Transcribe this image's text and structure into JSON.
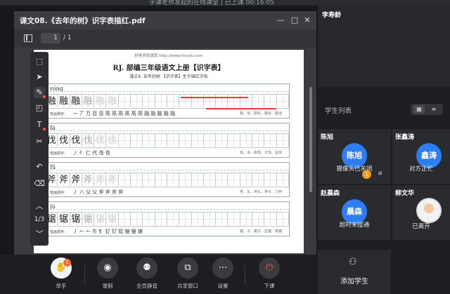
{
  "app": {
    "window_title": "字课老师发起的在线课堂 | 已上课 00:16:05"
  },
  "pdf": {
    "title": "课文08.《去年的树》识字表描红.pdf",
    "page_current": "1",
    "page_total": "/ 1",
    "site": "好老师资源库 http://www.hlszyk.com",
    "doc_title": "RJ. 部编三年级语文上册【识字表】",
    "doc_subtitle": "课文8. 去年的树 【识字表】生字描红字帖",
    "rows": [
      {
        "pinyin": "róng",
        "chars": [
          "融",
          "融",
          "融",
          "融",
          "融",
          "融",
          "",
          "",
          "",
          "",
          "",
          "",
          "",
          "",
          "",
          "",
          "",
          "",
          "",
          ""
        ],
        "words_label": "笔画顺序：",
        "strokes": "一 丆 万 百 百 鬲 鬲 鬲 鬲 鬲 鬲 融 融 融 融 融",
        "examples": "融、化、融化、融合、融洽"
      },
      {
        "pinyin": "fá",
        "chars": [
          "伐",
          "伐",
          "伐",
          "伐",
          "伐",
          "伐",
          "",
          "",
          "",
          "",
          "",
          "",
          "",
          "",
          "",
          "",
          "",
          "",
          "",
          ""
        ],
        "words_label": "笔画顺序：",
        "strokes": "丿 亻 仁 代 伐 伐",
        "examples": "伐、木、砍伐、讨伐、征伐"
      },
      {
        "pinyin": "fǔ",
        "chars": [
          "斧",
          "斧",
          "斧",
          "斧",
          "斧",
          "斧",
          "",
          "",
          "",
          "",
          "",
          "",
          "",
          "",
          "",
          "",
          "",
          "",
          "",
          ""
        ],
        "words_label": "笔画顺序：",
        "strokes": "丿 八 父 父 斧 斧 斧 斧",
        "examples": "斧、头、斧头、斧子、刀斧"
      },
      {
        "pinyin": "jù",
        "chars": [
          "锯",
          "锯",
          "锯",
          "锯",
          "锯",
          "锯",
          "",
          "",
          "",
          "",
          "",
          "",
          "",
          "",
          "",
          "",
          "",
          "",
          "",
          ""
        ],
        "words_label": "笔画顺序：",
        "strokes": "丿 𠂉 𠂉 牛 钅 钌 钌 铝 锯 锯 锯",
        "examples": "锯、子、锯子、拉锯、电锯"
      }
    ],
    "toolbar_pager": {
      "current": "1",
      "sep": "/",
      "total": "3"
    }
  },
  "right_panel": {
    "teacher_name": "李寿龄",
    "students_title": "学生列表",
    "students": [
      {
        "name": "陈旭",
        "avatar_text": "陈旭",
        "status": "摄像头已关闭",
        "hand_badge": "1"
      },
      {
        "name": "张鑫涛",
        "avatar_text": "鑫涛",
        "status": "对方正忙"
      },
      {
        "name": "赵晨森",
        "avatar_text": "晨森",
        "status": "超时未接通"
      },
      {
        "name": "柳文华",
        "avatar_text": "",
        "status": "已离开"
      }
    ],
    "add_student": "添加学生"
  },
  "bottom": {
    "buttons": [
      {
        "label": "举手",
        "badge": "1"
      },
      {
        "label": "录制"
      },
      {
        "label": "全员静音"
      },
      {
        "label": "共享窗口"
      },
      {
        "label": "设置"
      },
      {
        "label": "下课"
      }
    ]
  }
}
